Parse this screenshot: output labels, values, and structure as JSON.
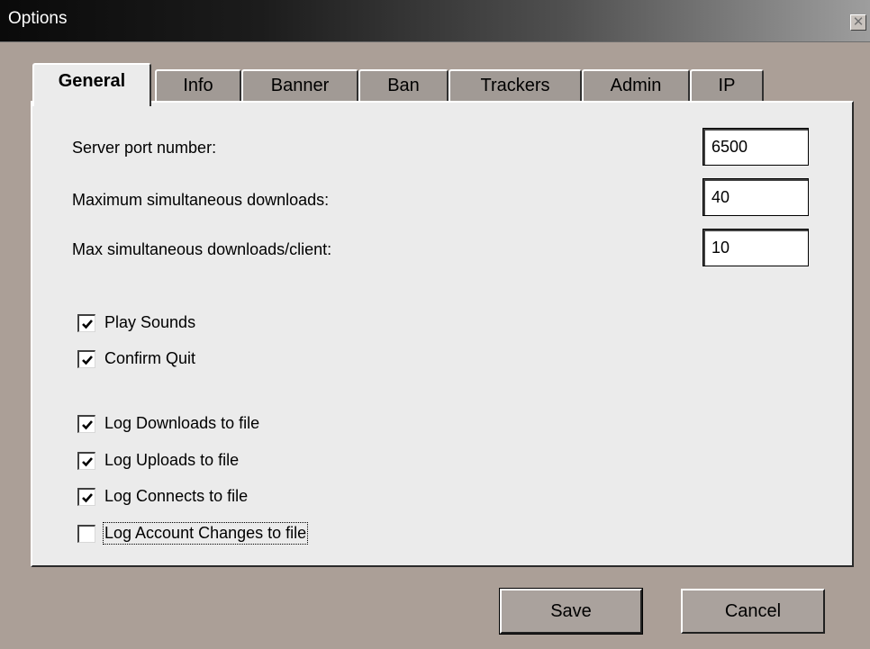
{
  "window": {
    "title": "Options",
    "close_symbol": "✕"
  },
  "tabs": [
    {
      "label": "General",
      "active": true
    },
    {
      "label": "Info",
      "active": false
    },
    {
      "label": "Banner",
      "active": false
    },
    {
      "label": "Ban",
      "active": false
    },
    {
      "label": "Trackers",
      "active": false
    },
    {
      "label": "Admin",
      "active": false
    },
    {
      "label": "IP",
      "active": false
    }
  ],
  "fields": [
    {
      "label": "Server port number:",
      "value": "6500"
    },
    {
      "label": "Maximum simultaneous downloads:",
      "value": "40"
    },
    {
      "label": "Max simultaneous downloads/client:",
      "value": "10"
    }
  ],
  "checkboxes": [
    {
      "label": "Play Sounds",
      "checked": true
    },
    {
      "label": "Confirm Quit",
      "checked": true
    },
    {
      "label": "Log Downloads to file",
      "checked": true
    },
    {
      "label": "Log Uploads to file",
      "checked": true
    },
    {
      "label": "Log Connects to file",
      "checked": true
    },
    {
      "label": "Log Account Changes to file",
      "checked": false
    }
  ],
  "buttons": {
    "save": "Save",
    "cancel": "Cancel"
  },
  "colors": {
    "window_bg": "#ab9f97",
    "panel_bg": "#ebebeb",
    "titlebar_dark": "#0a0a0a"
  },
  "icons": {
    "close": "close-icon",
    "check": "checkmark-icon"
  }
}
